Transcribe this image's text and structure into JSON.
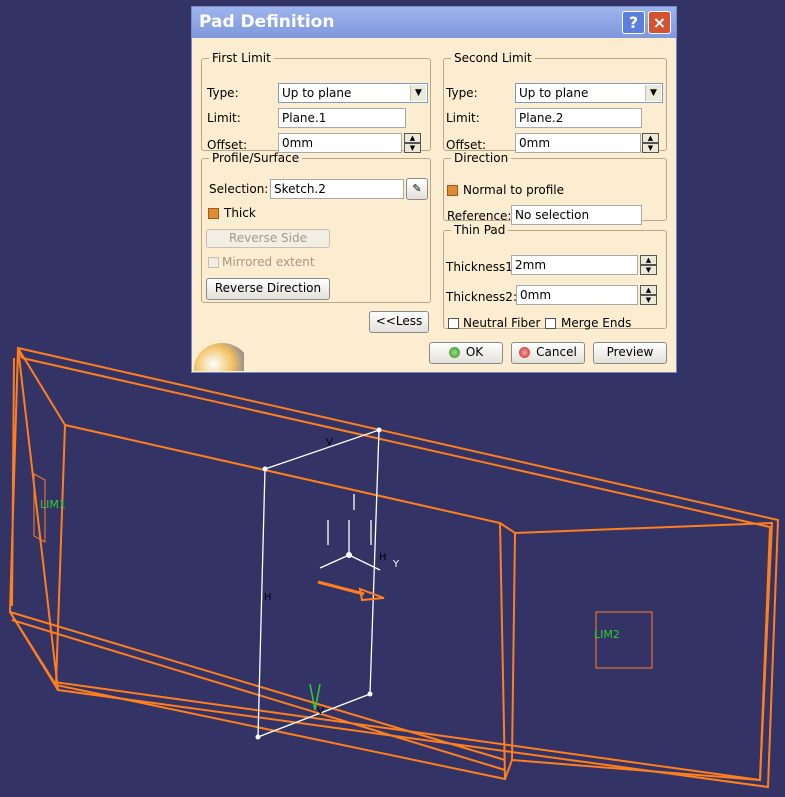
{
  "viewport": {
    "axis_v_top": "V",
    "axis_v_bottom": "V",
    "axis_h_left": "H",
    "axis_h_small": "H",
    "axis_y": "Y",
    "limit1": "LIM1",
    "limit2": "LIM2",
    "colors": {
      "background": "#333366",
      "pad_outline": "#ff7f1f",
      "sketch": "#ffffff",
      "limit_label": "#33cc33"
    }
  },
  "dialog": {
    "title": "Pad Definition",
    "help_button": "?",
    "close_button": "×",
    "first_limit": {
      "legend": "First Limit",
      "type_label": "Type:",
      "type_value": "Up to plane",
      "limit_label": "Limit:",
      "limit_value": "Plane.1",
      "offset_label": "Offset:",
      "offset_value": "0mm"
    },
    "second_limit": {
      "legend": "Second Limit",
      "type_label": "Type:",
      "type_value": "Up to plane",
      "limit_label": "Limit:",
      "limit_value": "Plane.2",
      "offset_label": "Offset:",
      "offset_value": "0mm"
    },
    "profile": {
      "legend": "Profile/Surface",
      "selection_label": "Selection:",
      "selection_value": "Sketch.2",
      "thick_label": "Thick",
      "thick_checked": true,
      "reverse_side_label": "Reverse Side",
      "mirrored_label": "Mirrored extent",
      "reverse_direction_label": "Reverse Direction"
    },
    "direction": {
      "legend": "Direction",
      "normal_label": "Normal to profile",
      "normal_checked": true,
      "reference_label": "Reference:",
      "reference_value": "No selection"
    },
    "thin_pad": {
      "legend": "Thin Pad",
      "thickness1_label": "Thickness1",
      "thickness1_value": "2mm",
      "thickness2_label": "Thickness2:",
      "thickness2_value": "0mm",
      "neutral_label": "Neutral Fiber",
      "merge_label": "Merge Ends"
    },
    "less_button": "<<Less",
    "ok_button": "OK",
    "cancel_button": "Cancel",
    "preview_button": "Preview"
  }
}
